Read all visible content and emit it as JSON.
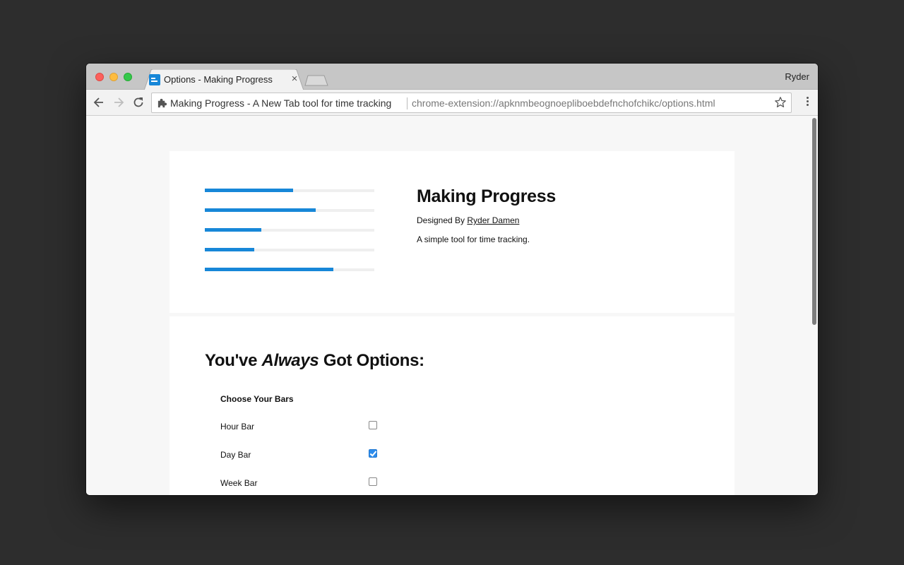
{
  "browser": {
    "tab": {
      "title": "Options - Making Progress",
      "favicon": "making-progress-favicon",
      "close_glyph": "×"
    },
    "profile_name": "Ryder",
    "omnibox": {
      "extension_name": "Making Progress - A New Tab tool for time tracking",
      "url": "chrome-extension://apknmbeognoepliboebdefnchofchikc/options.html"
    },
    "accent_color": "#1787d8"
  },
  "hero": {
    "progress_bars": [
      {
        "id": "bar-1",
        "fill_fraction": 0.52
      },
      {
        "id": "bar-2",
        "fill_fraction": 0.655
      },
      {
        "id": "bar-3",
        "fill_fraction": 0.333
      },
      {
        "id": "bar-4",
        "fill_fraction": 0.29
      },
      {
        "id": "bar-5",
        "fill_fraction": 0.76
      }
    ],
    "title": "Making Progress",
    "designed_by_prefix": "Designed By",
    "designer_name": "Ryder Damen",
    "tagline": "A simple tool for time tracking."
  },
  "options": {
    "heading_prefix": "You've",
    "heading_emphasis": "Always",
    "heading_suffix": "Got Options:",
    "section_title": "Choose Your Bars",
    "items": [
      {
        "label": "Hour Bar",
        "checked": false
      },
      {
        "label": "Day Bar",
        "checked": true
      },
      {
        "label": "Week Bar",
        "checked": false
      }
    ]
  }
}
